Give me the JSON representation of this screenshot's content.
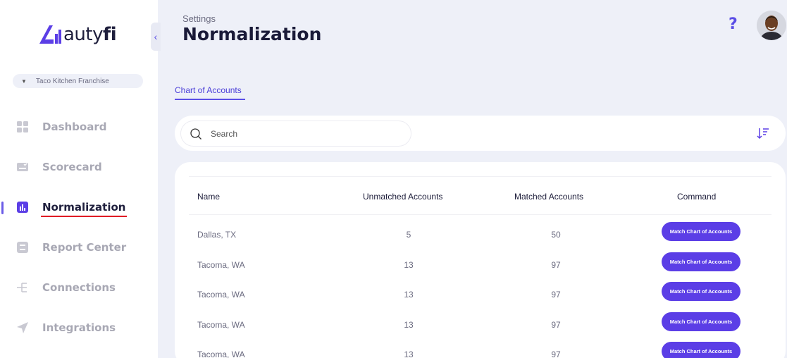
{
  "brand": {
    "name_prefix": "auty",
    "name_suffix": "fi",
    "accent": "#5b3ee6"
  },
  "sidebar": {
    "collapse_icon": "chevron-left-icon",
    "org_selector": "Taco Kitchen Franchise",
    "items": [
      {
        "label": "Dashboard",
        "icon": "grid-icon",
        "active": false
      },
      {
        "label": "Scorecard",
        "icon": "scorecard-icon",
        "active": false
      },
      {
        "label": "Normalization",
        "icon": "bar-chart-icon",
        "active": true
      },
      {
        "label": "Report Center",
        "icon": "report-list-icon",
        "active": false
      },
      {
        "label": "Connections",
        "icon": "connections-icon",
        "active": false
      },
      {
        "label": "Integrations",
        "icon": "send-icon",
        "active": false
      }
    ]
  },
  "header": {
    "breadcrumb": "Settings",
    "title": "Normalization",
    "help_label": "?"
  },
  "tabs": [
    {
      "label": "Chart of Accounts",
      "active": true
    }
  ],
  "search": {
    "placeholder": "Search"
  },
  "table": {
    "columns": [
      "Name",
      "Unmatched Accounts",
      "Matched Accounts",
      "Command"
    ],
    "rows": [
      {
        "name": "Dallas, TX",
        "unmatched": "5",
        "matched": "50",
        "command": "Match Chart of Accounts"
      },
      {
        "name": "Tacoma, WA",
        "unmatched": "13",
        "matched": "97",
        "command": "Match Chart of Accounts"
      },
      {
        "name": "Tacoma, WA",
        "unmatched": "13",
        "matched": "97",
        "command": "Match Chart of Accounts"
      },
      {
        "name": "Tacoma, WA",
        "unmatched": "13",
        "matched": "97",
        "command": "Match Chart of Accounts"
      },
      {
        "name": "Tacoma, WA",
        "unmatched": "13",
        "matched": "97",
        "command": "Match Chart of Accounts"
      }
    ]
  }
}
